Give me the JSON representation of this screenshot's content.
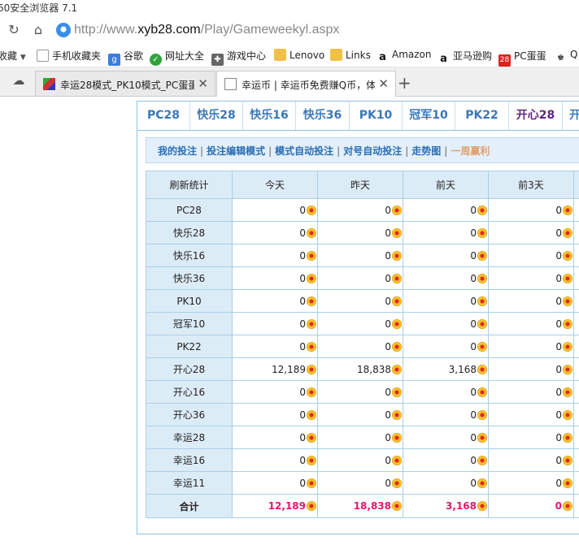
{
  "browser": {
    "title": "60安全浏览器 7.1",
    "url_prefix": "http://www.",
    "url_domain": "xyb28.com",
    "url_path": "/Play/Gameweekyl.aspx",
    "bookmarks": [
      "收藏",
      "手机收藏夹",
      "谷歌",
      "网址大全",
      "游戏中心",
      "Lenovo",
      "Links",
      "Amazon",
      "亚马逊购",
      "PC蛋蛋",
      "Q"
    ],
    "tabs": [
      "幸运28模式_PK10模式_PC蛋蛋",
      "幸运币 | 幸运币免费赚Q币，体"
    ]
  },
  "game_tabs": [
    "PC28",
    "快乐28",
    "快乐16",
    "快乐36",
    "PK10",
    "冠军10",
    "PK22",
    "开心28",
    "开"
  ],
  "subnav": [
    "我的投注",
    "投注编辑模式",
    "模式自动投注",
    "对号自动投注",
    "走势图",
    "一周赢利"
  ],
  "table": {
    "headers": [
      "刷新统计",
      "今天",
      "昨天",
      "前天",
      "前3天"
    ],
    "rows": [
      {
        "name": "PC28",
        "v": [
          "0",
          "0",
          "0",
          "0"
        ]
      },
      {
        "name": "快乐28",
        "v": [
          "0",
          "0",
          "0",
          "0"
        ]
      },
      {
        "name": "快乐16",
        "v": [
          "0",
          "0",
          "0",
          "0"
        ]
      },
      {
        "name": "快乐36",
        "v": [
          "0",
          "0",
          "0",
          "0"
        ]
      },
      {
        "name": "PK10",
        "v": [
          "0",
          "0",
          "0",
          "0"
        ]
      },
      {
        "name": "冠军10",
        "v": [
          "0",
          "0",
          "0",
          "0"
        ]
      },
      {
        "name": "PK22",
        "v": [
          "0",
          "0",
          "0",
          "0"
        ]
      },
      {
        "name": "开心28",
        "v": [
          "12,189",
          "18,838",
          "3,168",
          "0"
        ]
      },
      {
        "name": "开心16",
        "v": [
          "0",
          "0",
          "0",
          "0"
        ]
      },
      {
        "name": "开心36",
        "v": [
          "0",
          "0",
          "0",
          "0"
        ]
      },
      {
        "name": "幸运28",
        "v": [
          "0",
          "0",
          "0",
          "0"
        ]
      },
      {
        "name": "幸运16",
        "v": [
          "0",
          "0",
          "0",
          "0"
        ]
      },
      {
        "name": "幸运11",
        "v": [
          "0",
          "0",
          "0",
          "0"
        ]
      }
    ],
    "total": {
      "name": "合计",
      "v": [
        "12,189",
        "18,838",
        "3,168",
        "0"
      ]
    }
  }
}
